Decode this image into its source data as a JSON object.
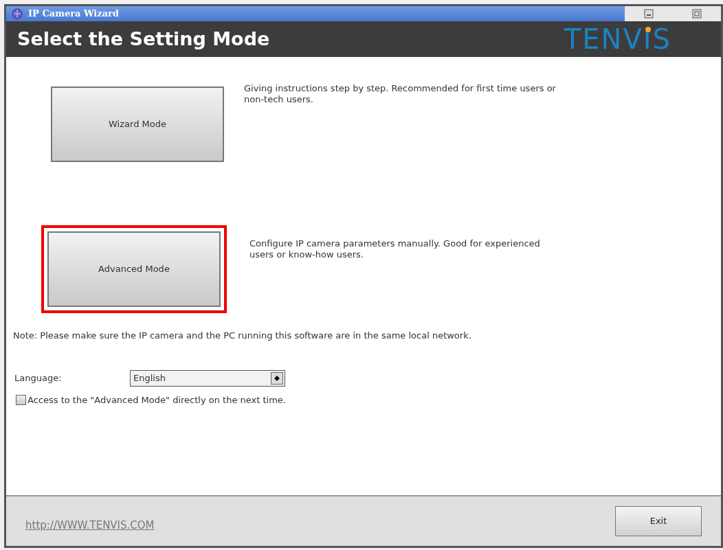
{
  "window": {
    "title": "IP Camera Wizard"
  },
  "header": {
    "title": "Select the Setting Mode",
    "logo": "TENVIS"
  },
  "modes": [
    {
      "label": "Wizard Mode",
      "description": "Giving instructions step by step. Recommended for first time users or non-tech users.",
      "highlighted": false
    },
    {
      "label": "Advanced Mode",
      "description": "Configure IP camera parameters manually. Good for experienced users or know-how users.",
      "highlighted": true
    }
  ],
  "note": "Note: Please make sure the IP camera and the PC running this software are in the same local network.",
  "language": {
    "label": "Language:",
    "value": "English"
  },
  "direct_access": {
    "label": "Access to the \"Advanced Mode\" directly on the next time.",
    "checked": false
  },
  "footer": {
    "link": "http://WWW.TENVIS.COM",
    "exit": "Exit"
  }
}
